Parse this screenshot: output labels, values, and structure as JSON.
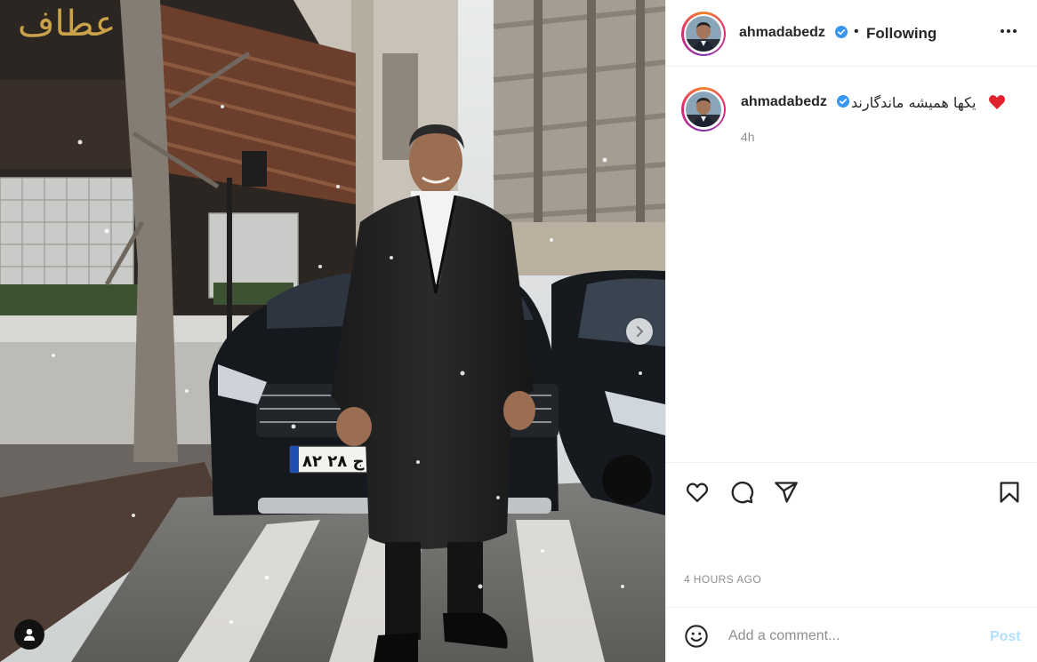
{
  "post": {
    "author": {
      "username": "ahmadabedz",
      "verified": true
    },
    "follow_status": "Following",
    "separator": "•",
    "caption": {
      "username": "ahmadabedz",
      "text": "یکها همیشه ماندگارند",
      "emoji": "red-heart",
      "time_ago": "4h"
    },
    "timestamp": "4 HOURS AGO",
    "photo": {
      "storefront_sign": "عطاف",
      "license_plate": "۸۲ ج ۲۸"
    }
  },
  "comment": {
    "placeholder": "Add a comment...",
    "post_label": "Post"
  },
  "icons": {
    "more": "more-options-icon",
    "like": "heart-icon",
    "comment": "comment-icon",
    "share": "share-icon",
    "save": "bookmark-icon",
    "emoji": "emoji-icon",
    "next": "chevron-right-icon",
    "tags": "user-tag-icon"
  },
  "colors": {
    "verified": "#3897f0",
    "post_disabled": "#b2dffc",
    "muted": "#8e8e8e",
    "text": "#262626"
  }
}
